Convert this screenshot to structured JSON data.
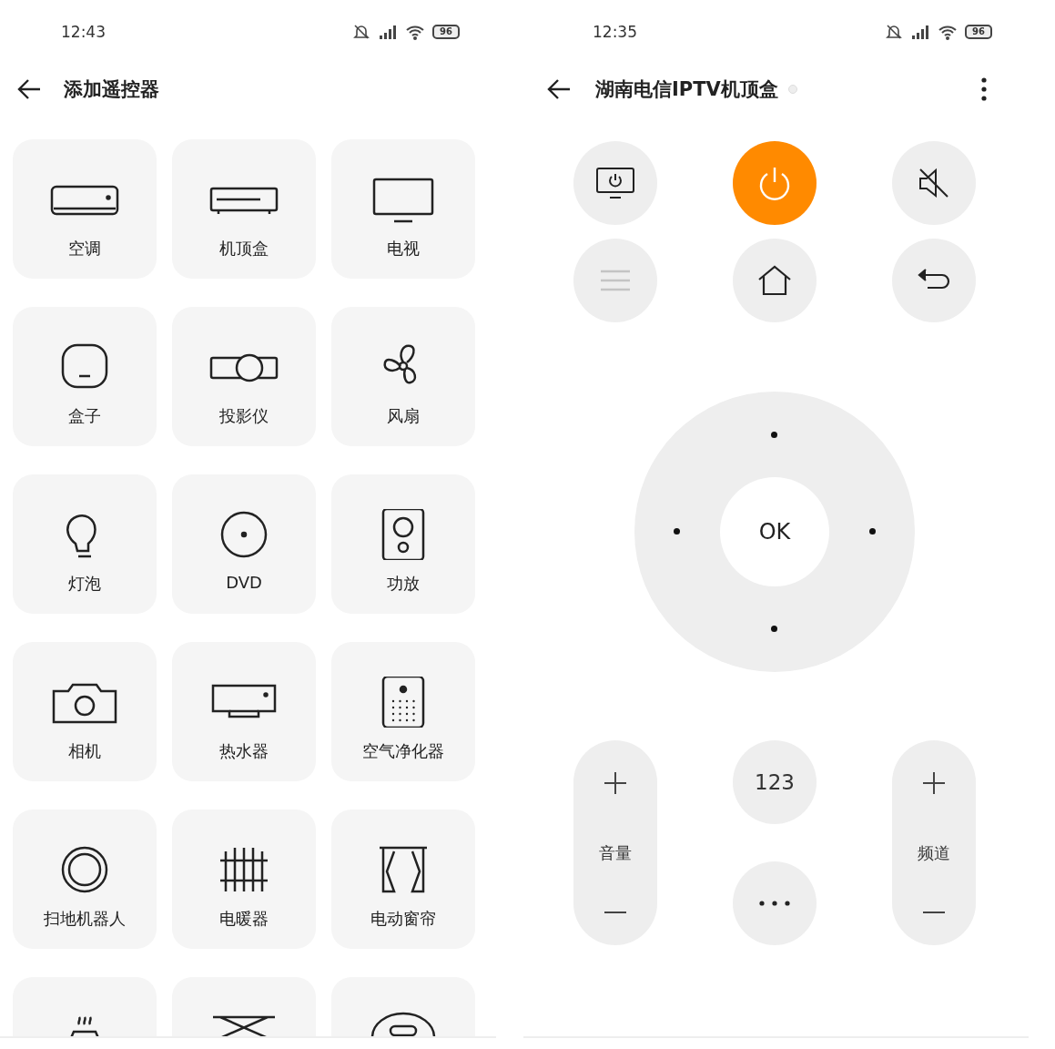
{
  "picker": {
    "status_bar": {
      "time": "12:43",
      "battery": "96"
    },
    "title": "添加遥控器",
    "tiles": [
      {
        "kind": "device",
        "label": "空调"
      },
      {
        "kind": "device",
        "label": "机顶盒"
      },
      {
        "kind": "device",
        "label": "电视"
      },
      {
        "kind": "device",
        "label": "盒子"
      },
      {
        "kind": "device",
        "label": "投影仪"
      },
      {
        "kind": "device",
        "label": "风扇"
      },
      {
        "kind": "device",
        "label": "灯泡"
      },
      {
        "kind": "device",
        "label": "DVD"
      },
      {
        "kind": "device",
        "label": "功放"
      },
      {
        "kind": "device",
        "label": "相机"
      },
      {
        "kind": "device",
        "label": "热水器"
      },
      {
        "kind": "device",
        "label": "空气净化器"
      },
      {
        "kind": "device",
        "label": "扫地机器人"
      },
      {
        "kind": "device",
        "label": "电暖器"
      },
      {
        "kind": "device",
        "label": "电动窗帘"
      },
      {
        "kind": "partial"
      },
      {
        "kind": "partial"
      },
      {
        "kind": "partial"
      }
    ]
  },
  "remote": {
    "status_bar": {
      "time": "12:35",
      "battery": "96"
    },
    "title": "湖南电信IPTV机顶盒",
    "buttons": [
      {
        "kind": "screen",
        "disabled": false
      },
      {
        "kind": "power",
        "disabled": false
      },
      {
        "kind": "mute",
        "disabled": false
      },
      {
        "kind": "menu",
        "disabled": true
      },
      {
        "kind": "home",
        "disabled": false
      },
      {
        "kind": "back",
        "disabled": false
      }
    ],
    "ok": "OK",
    "volume": {
      "label": "音量"
    },
    "keypad": "123",
    "channel": {
      "label": "频道"
    }
  }
}
